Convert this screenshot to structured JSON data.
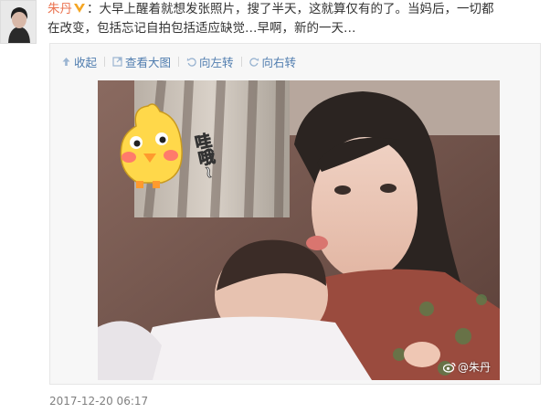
{
  "post": {
    "author": "朱丹",
    "text_line1": "：大早上醒着就想发张照片，搜了半天，这就算仅有的了。当妈后，一切都",
    "text_line2": "在改变，包括忘记自拍包括适应缺觉…早啊，新的一天…",
    "timestamp": "2017-12-20 06:17"
  },
  "toolbar": {
    "collapse_label": "收起",
    "view_large_label": "查看大图",
    "rotate_left_label": "向左转",
    "rotate_right_label": "向右转"
  },
  "photo": {
    "sticker_text": "哇哦~",
    "watermark_text": "@朱丹"
  },
  "colors": {
    "author": "#eb7350",
    "link": "#507daf",
    "date": "#808080",
    "vip_badge": "#f5a623"
  },
  "icons": [
    "avatar",
    "vip-badge-icon",
    "arrow-up-icon",
    "zoom-icon",
    "rotate-left-icon",
    "rotate-right-icon",
    "weibo-logo-icon"
  ]
}
